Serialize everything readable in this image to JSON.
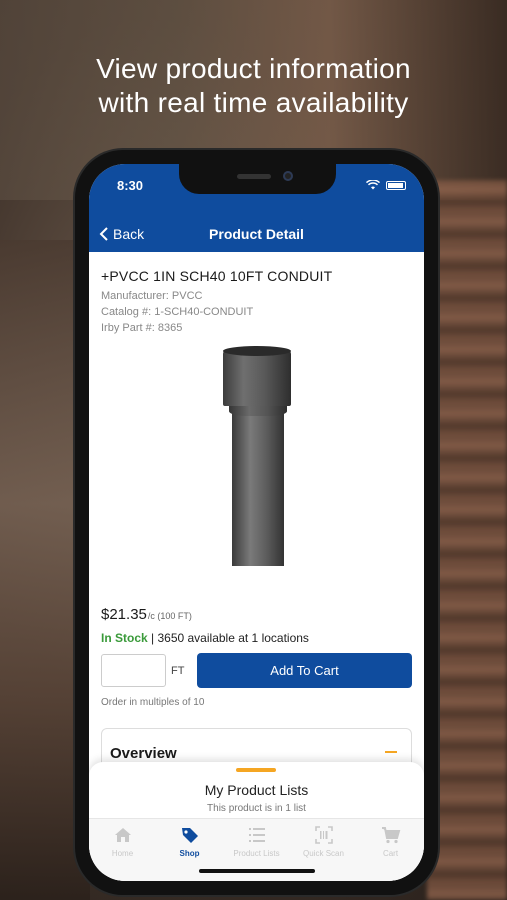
{
  "headline": {
    "line1": "View product information",
    "line2": "with real time availability"
  },
  "status_bar": {
    "time": "8:30"
  },
  "nav": {
    "back_label": "Back",
    "title": "Product Detail"
  },
  "product": {
    "title": "+PVCC 1IN SCH40 10FT CONDUIT",
    "manufacturer": "Manufacturer: PVCC",
    "catalog": "Catalog #: 1-SCH40-CONDUIT",
    "part": "Irby Part #: 8365",
    "price": "$21.35",
    "price_unit": "/c (100 FT)",
    "stock_status": "In Stock",
    "availability": "| 3650 available at 1 locations",
    "qty_value": "",
    "qty_unit": "FT",
    "add_to_cart_label": "Add To Cart",
    "multiples_note": "Order in multiples of 10"
  },
  "overview": {
    "title": "Overview"
  },
  "product_lists_sheet": {
    "title": "My Product Lists",
    "subtitle": "This product is in 1 list"
  },
  "tabs": [
    {
      "label": "Home",
      "icon": "home-icon",
      "active": false
    },
    {
      "label": "Shop",
      "icon": "tag-icon",
      "active": true
    },
    {
      "label": "Product Lists",
      "icon": "list-icon",
      "active": false
    },
    {
      "label": "Quick Scan",
      "icon": "barcode-icon",
      "active": false
    },
    {
      "label": "Cart",
      "icon": "cart-icon",
      "active": false
    }
  ],
  "colors": {
    "brand_blue": "#0f4c9e",
    "accent_orange": "#f5a623",
    "stock_green": "#3a9a3a"
  }
}
